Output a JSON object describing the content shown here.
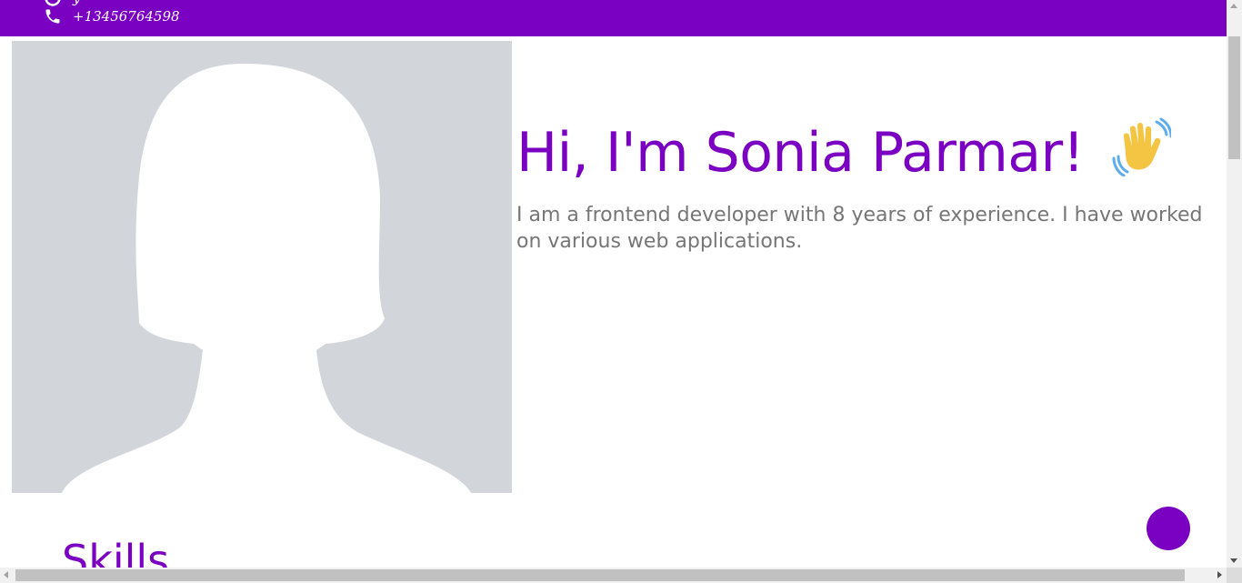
{
  "header": {
    "email_icon": "email-icon",
    "phone_icon": "phone-icon",
    "phone": "+13456764598",
    "background_color": "#7a00c2"
  },
  "hero": {
    "photo_icon": "avatar-placeholder-female",
    "title": "Hi, I'm Sonia Parmar!",
    "title_emoji_icon": "waving-hand-emoji",
    "description": "I am a frontend developer with 8 years of experience. I have worked on various web applications.",
    "title_color": "#7a00c2",
    "description_color": "#767676"
  },
  "skills": {
    "heading": "Skills"
  },
  "fab": {
    "icon": "fab-button",
    "color": "#7a00c2"
  }
}
